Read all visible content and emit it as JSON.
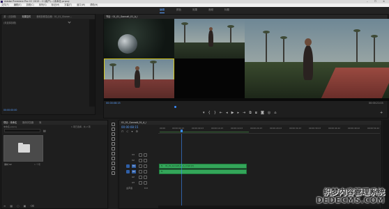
{
  "window": {
    "title": "Adobe Premiere Pro CC 2015 - C:\\用户\\...\\未命名.prproj",
    "controls": "–  ☐  ✕"
  },
  "menu": [
    "文件(F)",
    "编辑(E)",
    "剪辑(C)",
    "序列(S)",
    "标记(M)",
    "字幕(T)",
    "窗口(W)",
    "帮助(H)"
  ],
  "workspace": {
    "tabs": [
      "编辑",
      "颜色",
      "效果",
      "音频",
      "标题"
    ],
    "active": "编辑"
  },
  "source_panel": {
    "tabs": [
      "源：(无剪辑)",
      "效果控件",
      "音频剪辑混合器：01_01_Gtoner...",
      "元数据"
    ],
    "active_tab": "效果控件",
    "empty_text": "(未选择剪辑)",
    "timecode": "00:00:00:00"
  },
  "program_monitor": {
    "tab": "节目：01_01_GonnaIt_01_A_l",
    "timecode_in": "00:00:08:15",
    "timecode_out": "00:00:21:03",
    "fit": "适合",
    "quality": "1/2"
  },
  "project_panel": {
    "tabs": [
      "项目：未命名",
      "媒体浏览器",
      "库",
      "信息"
    ],
    "path": "未命名.prproj",
    "item_count": "1 项已选择，共 2 项",
    "search_placeholder": "",
    "bin": {
      "name": "素材 02",
      "meta": "1 个项"
    }
  },
  "timeline": {
    "tab": "01_01_GonnaIt_01_A_l",
    "timecode": "00:00:08:15",
    "ruler": [
      "00:00",
      "00:00:04:23",
      "00:00:09:23",
      "00:00:14:23",
      "00:00:19:23",
      "00:00:24:23",
      "00:00:29:23",
      "00:00:34:23",
      "00:00:39:23",
      "00:00:44:22",
      "00:00:49:22",
      "00:00:54:22"
    ],
    "video_tracks": [
      "V3",
      "V2",
      "V1"
    ],
    "audio_tracks": [
      "A1",
      "A2",
      "A3"
    ],
    "master": "主声道",
    "master_value": "0.0",
    "clips": {
      "video": "01_01_GonnaIt_01_A_l.mp4 [V]",
      "video_fx": "fx",
      "audio": "fx"
    }
  },
  "watermark": {
    "line1": "织梦内容管理系统",
    "line2": "DEDECMS.COM"
  },
  "colors": {
    "accent": "#5aa0ff",
    "selection": "#d8c81a",
    "clip_green": "#34a65a",
    "playhead": "#3a8dff"
  }
}
